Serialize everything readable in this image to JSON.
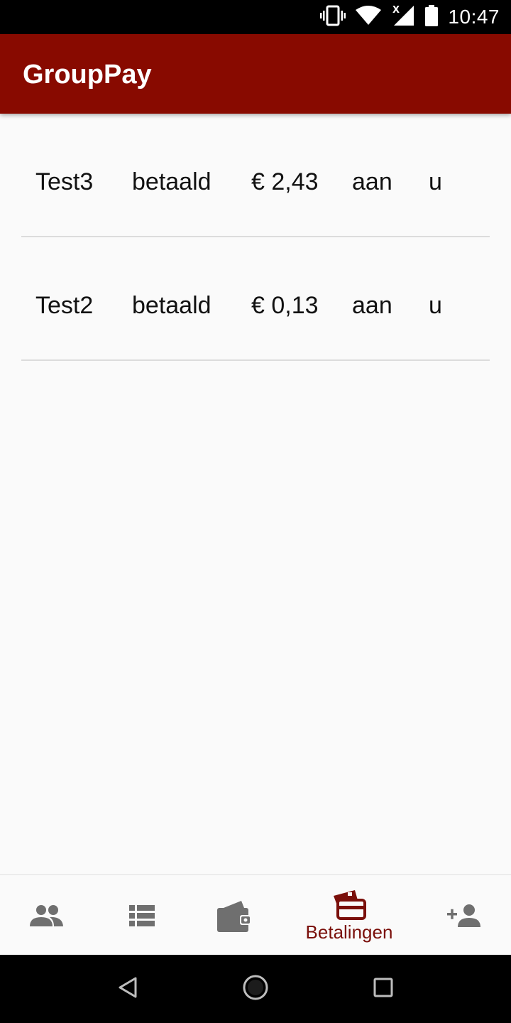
{
  "status_bar": {
    "time": "10:47",
    "icons": [
      "vibrate-icon",
      "wifi-icon",
      "cell-signal-icon",
      "battery-icon"
    ]
  },
  "app_bar": {
    "title": "GroupPay",
    "color": "#880a00"
  },
  "payments": [
    {
      "name": "Test3",
      "status": "betaald",
      "amount": "€ 2,43",
      "prep": "aan",
      "recipient": "u"
    },
    {
      "name": "Test2",
      "status": "betaald",
      "amount": "€ 0,13",
      "prep": "aan",
      "recipient": "u"
    }
  ],
  "bottom_nav": {
    "items": [
      {
        "icon": "group-icon",
        "label": ""
      },
      {
        "icon": "list-icon",
        "label": ""
      },
      {
        "icon": "wallet-icon",
        "label": ""
      },
      {
        "icon": "payments-icon",
        "label": "Betalingen",
        "active": true
      },
      {
        "icon": "add-person-icon",
        "label": ""
      }
    ],
    "active_color": "#7a0f0a",
    "inactive_color": "#6f6f6f"
  },
  "system_nav": {
    "icons": [
      "back-icon",
      "home-icon",
      "recents-icon"
    ]
  }
}
